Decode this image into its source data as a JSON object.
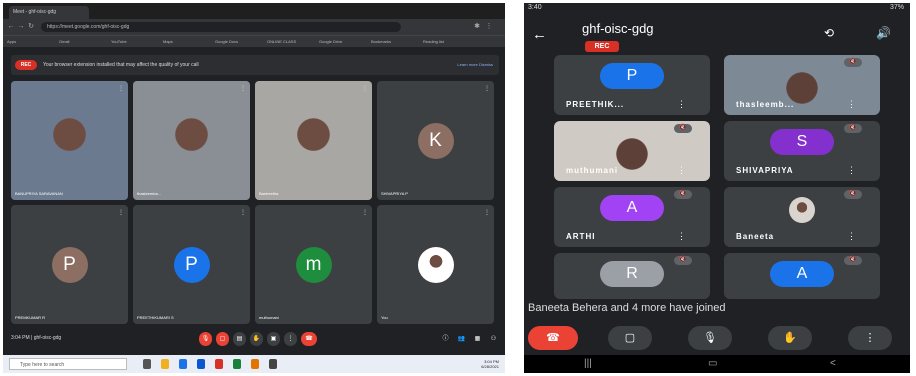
{
  "desktop": {
    "tab_label": "Meet - ghf-oisc-gdg",
    "url": "https://meet.google.com/ghf-oisc-gdg",
    "bookmarks": [
      "Apps",
      "Gmail",
      "YouTube",
      "Maps",
      "Google Docs",
      "ONLINE CLASS",
      "Google Drive",
      "Bookmarks",
      "Reading list"
    ],
    "banner_rec": "REC",
    "banner_text": "Your browser extension installed that may affect the quality of your call",
    "banner_links": "Learn more   Dismiss",
    "tiles": [
      {
        "name": "BANUPRIYA SARAVANAN",
        "kind": "cam",
        "tint": "#6b7a8f"
      },
      {
        "name": "thasleemba...",
        "kind": "cam",
        "tint": "#8a8f96"
      },
      {
        "name": "Banheetha",
        "kind": "cam",
        "tint": "#a9a7a3"
      },
      {
        "name": "SHIVAPRIYA P",
        "kind": "avatar",
        "letter": "K",
        "color": "#8d6e63"
      },
      {
        "name": "PREMKUMAR R",
        "kind": "avatar",
        "letter": "P",
        "color": "#8d6e63"
      },
      {
        "name": "PREETHIKUMARI S",
        "kind": "avatar",
        "letter": "P",
        "color": "#1a73e8"
      },
      {
        "name": "muthumani",
        "kind": "avatar",
        "letter": "m",
        "color": "#1e8e3e"
      },
      {
        "name": "You",
        "kind": "photo",
        "letter": "",
        "color": "#ffffff"
      }
    ],
    "meeting_info": "3:04 PM  |  ghf-oisc-gdg",
    "taskbar_search": "Type here to search",
    "tray_time": "3:04 PM",
    "tray_date": "6/28/2021"
  },
  "phone": {
    "status_time": "3:40",
    "status_right": "37%",
    "title": "ghf-oisc-gdg",
    "rec": "REC",
    "tiles": [
      {
        "label": "PREETHIK...",
        "letter": "P",
        "color": "#1a73e8",
        "kind": "avatar"
      },
      {
        "label": "thasleemb...",
        "letter": "",
        "color": "#7d8a96",
        "kind": "cam"
      },
      {
        "label": "muthumani",
        "letter": "",
        "color": "#cfcac4",
        "kind": "cam"
      },
      {
        "label": "SHIVAPRIYA",
        "letter": "S",
        "color": "#8430ce",
        "kind": "avatar"
      },
      {
        "label": "ARTHI",
        "letter": "A",
        "color": "#a142f4",
        "kind": "avatar"
      },
      {
        "label": "Baneeta",
        "letter": "",
        "color": "#d9d4cd",
        "kind": "photo"
      },
      {
        "label": "",
        "letter": "R",
        "color": "#9aa0a6",
        "kind": "avatar"
      },
      {
        "label": "",
        "letter": "A",
        "color": "#1a73e8",
        "kind": "avatar"
      }
    ],
    "joined_text": "Baneeta Behera and 4 more have joined"
  }
}
